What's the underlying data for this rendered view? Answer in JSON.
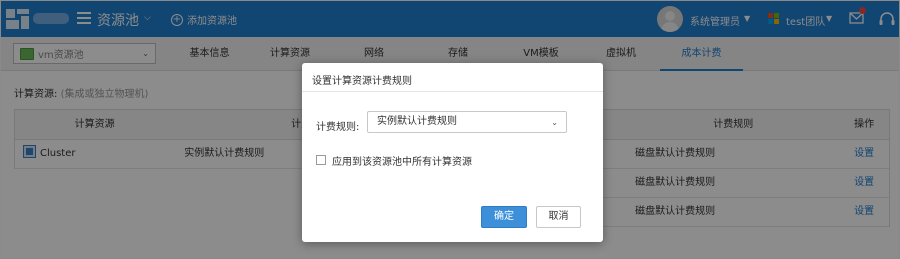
{
  "header": {
    "menu_title": "资源池",
    "add_pool": "添加资源池",
    "user": "系统管理员",
    "team": "test团队"
  },
  "subnav": {
    "pool_select": "vm资源池",
    "tabs": [
      {
        "label": "基本信息"
      },
      {
        "label": "计算资源"
      },
      {
        "label": "网络"
      },
      {
        "label": "存储"
      },
      {
        "label": "VM模板"
      },
      {
        "label": "虚拟机"
      },
      {
        "label": "成本计费",
        "active": true
      }
    ]
  },
  "compute": {
    "section_title": "计算资源:",
    "section_hint": "(集成或独立物理机)",
    "columns": [
      "计算资源",
      "计费规则"
    ],
    "rows": [
      {
        "name": "Cluster",
        "rule": "实例默认计费规则"
      }
    ]
  },
  "storage": {
    "columns": [
      "计费规则",
      "操作"
    ],
    "rows": [
      {
        "rule": "磁盘默认计费规则",
        "action": "设置"
      },
      {
        "rule": "磁盘默认计费规则",
        "action": "设置"
      },
      {
        "rule": "磁盘默认计费规则",
        "action": "设置"
      }
    ]
  },
  "dialog": {
    "title": "设置计算资源计费规则",
    "rule_label": "计费规则:",
    "rule_value": "实例默认计费规则",
    "apply_all_label": "应用到该资源池中所有计算资源",
    "ok": "确定",
    "cancel": "取消"
  },
  "colors": {
    "primary": "#1f7fcf",
    "button_primary": "#3d8fd9",
    "overlay": "rgba(0,0,0,0.45)"
  },
  "icons": [
    "logo-icon",
    "menu-icon",
    "chevron-down-icon",
    "plus-circle-icon",
    "avatar",
    "team-icon",
    "message-icon",
    "headset-icon",
    "vm-pool-icon",
    "cluster-icon"
  ]
}
